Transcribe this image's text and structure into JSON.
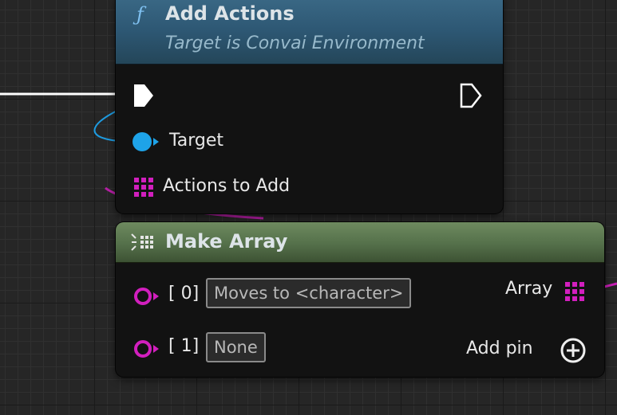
{
  "add_actions": {
    "title": "Add Actions",
    "subtitle": "Target is Convai Environment",
    "func_symbol": "ƒ",
    "header_color": "#2d5773",
    "pins": {
      "target": "Target",
      "actions_to_add": "Actions to Add"
    }
  },
  "make_array": {
    "title": "Make Array",
    "header_color": "#54704a",
    "inputs": [
      {
        "index": "[ 0]",
        "value": "Moves to <character>"
      },
      {
        "index": "[ 1]",
        "value": "None"
      }
    ],
    "output": "Array",
    "add_pin": "Add pin"
  },
  "colors": {
    "exec": "#ffffff",
    "object_pin": "#1ea3e8",
    "struct_pin": "#d21fbe"
  },
  "icons": [
    "function-icon",
    "exec-in-pin-icon",
    "exec-out-pin-icon",
    "object-pin-icon",
    "array-pin-icon",
    "make-array-icon",
    "add-pin-icon"
  ]
}
